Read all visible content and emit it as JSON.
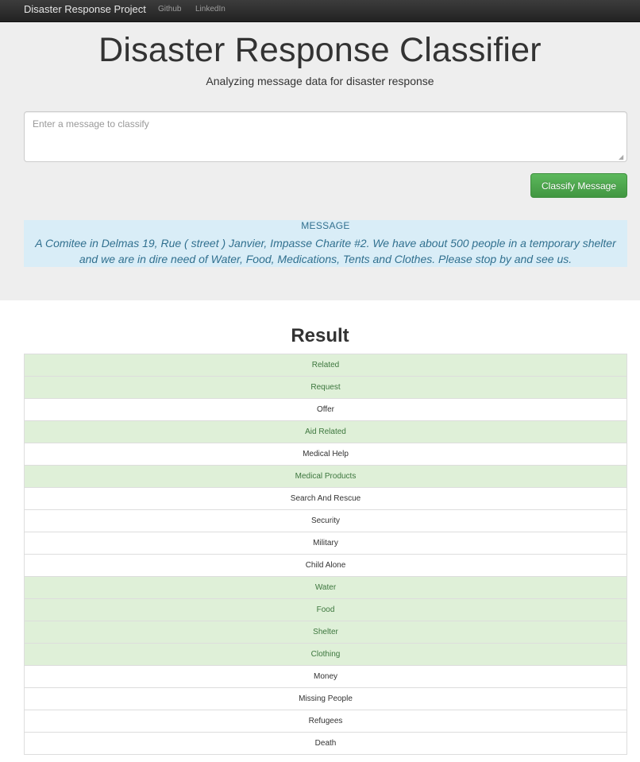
{
  "navbar": {
    "brand": "Disaster Response Project",
    "links": [
      "Github",
      "LinkedIn"
    ]
  },
  "header": {
    "title": "Disaster Response Classifier",
    "subtitle": "Analyzing message data for disaster response"
  },
  "form": {
    "placeholder": "Enter a message to classify",
    "value": "",
    "button_label": "Classify Message"
  },
  "message": {
    "label": "MESSAGE",
    "text": "A Comitee in Delmas 19, Rue ( street ) Janvier, Impasse Charite #2. We have about 500 people in a temporary shelter and we are in dire need of Water, Food, Medications, Tents and Clothes. Please stop by and see us."
  },
  "result": {
    "title": "Result",
    "categories": [
      {
        "label": "Related",
        "positive": true
      },
      {
        "label": "Request",
        "positive": true
      },
      {
        "label": "Offer",
        "positive": false
      },
      {
        "label": "Aid Related",
        "positive": true
      },
      {
        "label": "Medical Help",
        "positive": false
      },
      {
        "label": "Medical Products",
        "positive": true
      },
      {
        "label": "Search And Rescue",
        "positive": false
      },
      {
        "label": "Security",
        "positive": false
      },
      {
        "label": "Military",
        "positive": false
      },
      {
        "label": "Child Alone",
        "positive": false
      },
      {
        "label": "Water",
        "positive": true
      },
      {
        "label": "Food",
        "positive": true
      },
      {
        "label": "Shelter",
        "positive": true
      },
      {
        "label": "Clothing",
        "positive": true
      },
      {
        "label": "Money",
        "positive": false
      },
      {
        "label": "Missing People",
        "positive": false
      },
      {
        "label": "Refugees",
        "positive": false
      },
      {
        "label": "Death",
        "positive": false
      }
    ]
  },
  "colors": {
    "positive_bg": "#dff0d8",
    "positive_text": "#3c763d",
    "message_bg": "#d9edf7",
    "message_text": "#31708f",
    "button": "#5cb85c"
  }
}
